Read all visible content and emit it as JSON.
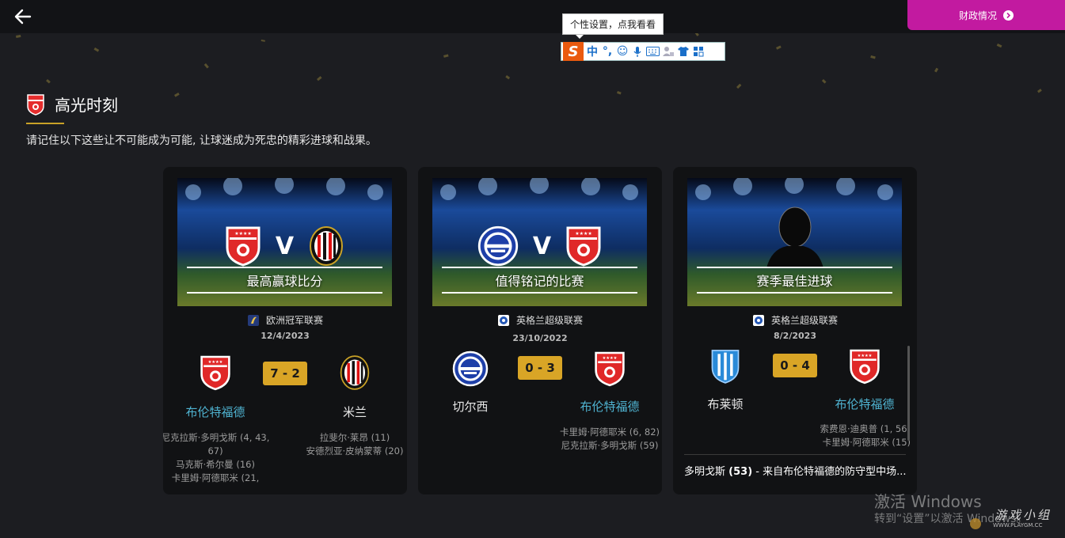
{
  "topbar": {
    "finance_label": "财政情况"
  },
  "ime": {
    "tooltip": "个性设置，点我看看",
    "logo": "S",
    "items": [
      "中",
      "°,",
      "☺",
      "mic-icon",
      "keyboard-icon",
      "user-icon",
      "shirt-icon",
      "grid-icon"
    ]
  },
  "section": {
    "title": "高光时刻",
    "description": "请记住以下这些让不可能成为可能, 让球迷成为死忠的精彩进球和战果。"
  },
  "colors": {
    "accent_pink": "#c21aa0",
    "score_gold": "#d9a526",
    "link_blue": "#4fb3d1"
  },
  "cards": [
    {
      "banner_label": "最高赢球比分",
      "banner_vs": "V",
      "competition": "欧洲冠军联赛",
      "date": "12/4/2023",
      "score": "7 - 2",
      "home": {
        "name": "布伦特福德",
        "crest": "brentford-crest",
        "is_link": true
      },
      "away": {
        "name": "米兰",
        "crest": "milan-crest",
        "is_link": false
      },
      "home_scorers": "尼克拉斯·多明戈斯 (4, 43, 67)\n马克斯·希尔曼 (16)\n卡里姆·阿德耶米 (21,",
      "away_scorers": "拉斐尔·莱昂 (11)\n安德烈亚·皮纳蒙蒂 (20)"
    },
    {
      "banner_label": "值得铭记的比赛",
      "banner_vs": "V",
      "competition": "英格兰超级联赛",
      "date": "23/10/2022",
      "score": "0 - 3",
      "home": {
        "name": "切尔西",
        "crest": "chelsea-crest",
        "is_link": false
      },
      "away": {
        "name": "布伦特福德",
        "crest": "brentford-crest",
        "is_link": true
      },
      "home_scorers": "",
      "away_scorers": "卡里姆·阿德耶米 (6, 82)\n尼克拉斯·多明戈斯 (59)"
    },
    {
      "banner_label": "赛季最佳进球",
      "competition": "英格兰超级联赛",
      "date": "8/2/2023",
      "score": "0 - 4",
      "home": {
        "name": "布莱顿",
        "crest": "brighton-crest",
        "is_link": false
      },
      "away": {
        "name": "布伦特福德",
        "crest": "brentford-crest",
        "is_link": true
      },
      "home_scorers": "",
      "away_scorers": "索费恩·迪奥普 (1, 56)\n卡里姆·阿德耶米 (15)",
      "player_name": "多明戈斯",
      "player_rating": "(53)",
      "player_desc": " - 来自布伦特福德的防守型中场..."
    }
  ],
  "watermark": {
    "line1": "激活 Windows",
    "line2": "转到“设置”以激活 Windows。",
    "site": "游戏小组",
    "site_url": "WWW.PLAYGM.CC"
  }
}
